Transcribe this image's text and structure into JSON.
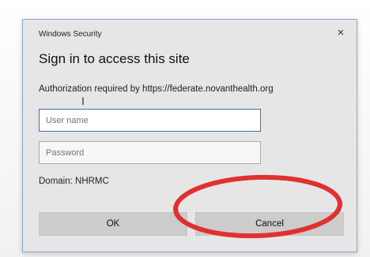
{
  "dialog": {
    "window_title": "Windows Security",
    "close_glyph": "×",
    "heading": "Sign in to access this site",
    "auth_message": "Authorization required by https://federate.novanthealth.org",
    "username": {
      "value": "",
      "placeholder": "User name"
    },
    "password": {
      "value": "",
      "placeholder": "Password"
    },
    "domain_text": "Domain: NHRMC",
    "ok_label": "OK",
    "cancel_label": "Cancel"
  },
  "annotation": {
    "color": "#e03030"
  }
}
